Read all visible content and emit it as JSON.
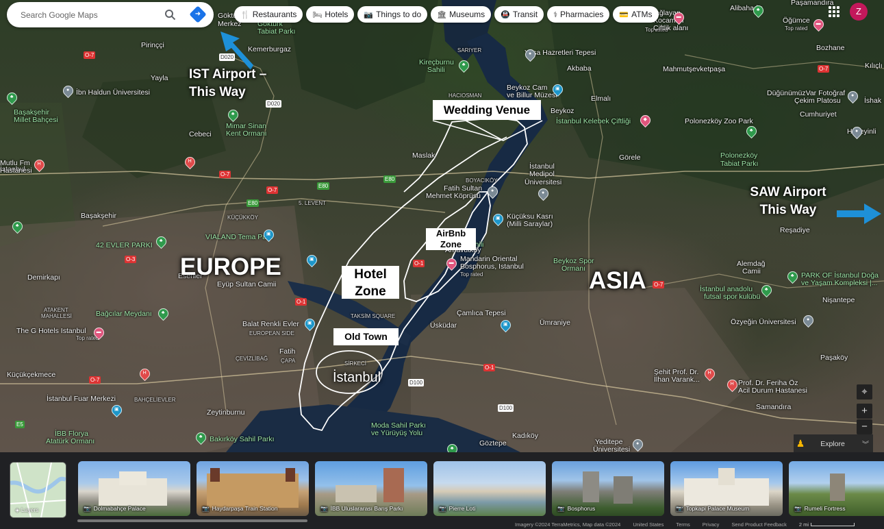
{
  "search": {
    "placeholder": "Search Google Maps"
  },
  "chips": [
    {
      "icon": "restaurant-icon",
      "glyph": "🍴",
      "label": "Restaurants"
    },
    {
      "icon": "bed-icon",
      "glyph": "🛏",
      "label": "Hotels"
    },
    {
      "icon": "camera-icon",
      "glyph": "📷",
      "label": "Things to do"
    },
    {
      "icon": "museum-icon",
      "glyph": "🏛",
      "label": "Museums"
    },
    {
      "icon": "transit-icon",
      "glyph": "🚇",
      "label": "Transit"
    },
    {
      "icon": "pharmacy-icon",
      "glyph": "⚕",
      "label": "Pharmacies"
    },
    {
      "icon": "atm-icon",
      "glyph": "💳",
      "label": "ATMs"
    }
  ],
  "user": {
    "initial": "Z"
  },
  "annotations": {
    "europe": "EUROPE",
    "asia": "ASIA",
    "ist_airport_1": "IST Airport –",
    "ist_airport_2": "This Way",
    "saw_airport_1": "SAW Airport",
    "saw_airport_2": "This Way",
    "wedding_venue": "Wedding Venue",
    "airbnb_1": "AirBnb",
    "airbnb_2": "Zone",
    "hotel_1": "Hotel",
    "hotel_2": "Zone",
    "old_town": "Old Town"
  },
  "accent": {
    "arrow": "#1e90d8",
    "route": "#ffffff"
  },
  "places": [
    {
      "text": "Kemerburgaz",
      "style": ""
    },
    {
      "text": "Göktürk",
      "style": ""
    },
    {
      "text": "Merkez",
      "style": ""
    },
    {
      "text": "Göktürk",
      "style": "green"
    },
    {
      "text": "Tabiat Parkı",
      "style": "green"
    },
    {
      "text": "Pirinççi",
      "style": ""
    },
    {
      "text": "Yayla",
      "style": ""
    },
    {
      "text": "İbn Haldun Üniversitesi",
      "style": ""
    },
    {
      "text": "Başakşehir",
      "style": "green"
    },
    {
      "text": "Millet Bahçesi",
      "style": "green"
    },
    {
      "text": "Cebeci",
      "style": ""
    },
    {
      "text": "Mimar Sinan",
      "style": "green"
    },
    {
      "text": "Kent Ormanı",
      "style": "green"
    },
    {
      "text": "Başakşehir",
      "style": ""
    },
    {
      "text": "42 EVLER PARKI",
      "style": "green"
    },
    {
      "text": "VIALAND Tema Park",
      "style": "green"
    },
    {
      "text": "Eyüp Sultan Camii",
      "style": ""
    },
    {
      "text": "Bağcılar Meydanı",
      "style": "green"
    },
    {
      "text": "The G Hotels Istanbul",
      "style": ""
    },
    {
      "text": "Top rated",
      "style": "road"
    },
    {
      "text": "Balat Renkli Evler",
      "style": ""
    },
    {
      "text": "Fatih",
      "style": ""
    },
    {
      "text": "Küçükçekmece",
      "style": ""
    },
    {
      "text": "İstanbul Fuar Merkezi",
      "style": ""
    },
    {
      "text": "Zeytinburnu",
      "style": ""
    },
    {
      "text": "İBB Florya",
      "style": "green"
    },
    {
      "text": "Atatürk Ormanı",
      "style": "green"
    },
    {
      "text": "Bakırköy Sahil Parkı",
      "style": "green"
    },
    {
      "text": "Moda Sahil Parkı",
      "style": "green"
    },
    {
      "text": "ve Yürüyüş Yolu",
      "style": "green"
    },
    {
      "text": "Kadıköy",
      "style": ""
    },
    {
      "text": "Göztepe",
      "style": ""
    },
    {
      "text": "Yeditepe",
      "style": ""
    },
    {
      "text": "Üniversitesi",
      "style": ""
    },
    {
      "text": "Üsküdar",
      "style": ""
    },
    {
      "text": "Çamlıca Tepesi",
      "style": ""
    },
    {
      "text": "Ümraniye",
      "style": ""
    },
    {
      "text": "Mandarin Oriental",
      "style": ""
    },
    {
      "text": "Bosphorus, Istanbul",
      "style": ""
    },
    {
      "text": "Top rated",
      "style": "road"
    },
    {
      "text": "Küçüksu Kasrı",
      "style": ""
    },
    {
      "text": "(Milli Saraylar)",
      "style": ""
    },
    {
      "text": "Fatih Sultan",
      "style": ""
    },
    {
      "text": "Mehmet Köprüsü",
      "style": ""
    },
    {
      "text": "Maslak",
      "style": ""
    },
    {
      "text": "İstanbul",
      "style": ""
    },
    {
      "text": "Medipol",
      "style": ""
    },
    {
      "text": "Üniversitesi",
      "style": ""
    },
    {
      "text": "Beykoz Cam",
      "style": ""
    },
    {
      "text": "ve Billur Müzesi",
      "style": ""
    },
    {
      "text": "Beykoz",
      "style": ""
    },
    {
      "text": "İstanbul Kelebek Çiftliği",
      "style": "green"
    },
    {
      "text": "Yuşa Hazretleri Tepesi",
      "style": ""
    },
    {
      "text": "Akbaba",
      "style": ""
    },
    {
      "text": "Kireçburnu",
      "style": "green"
    },
    {
      "text": "Sahili",
      "style": "green"
    },
    {
      "text": "SARIYER",
      "style": "road"
    },
    {
      "text": "Elmalı",
      "style": ""
    },
    {
      "text": "Görele",
      "style": ""
    },
    {
      "text": "Polonezköy Zoo Park",
      "style": ""
    },
    {
      "text": "Polonezköy",
      "style": "green"
    },
    {
      "text": "Tabiat Parkı",
      "style": "green"
    },
    {
      "text": "Mahmutşevketpaşa",
      "style": ""
    },
    {
      "text": "Alibahadır",
      "style": ""
    },
    {
      "text": "Paşamandıra",
      "style": ""
    },
    {
      "text": "Öğümce",
      "style": ""
    },
    {
      "text": "Top rated",
      "style": "road"
    },
    {
      "text": "Bozhane",
      "style": ""
    },
    {
      "text": "Kılıçlı",
      "style": ""
    },
    {
      "text": "DüğünümüzVar Fotoğraf",
      "style": ""
    },
    {
      "text": "Çekim Platosu",
      "style": ""
    },
    {
      "text": "Cumhuriyet",
      "style": ""
    },
    {
      "text": "İshak",
      "style": ""
    },
    {
      "text": "Hüseyinli",
      "style": ""
    },
    {
      "text": "Reşadiye",
      "style": ""
    },
    {
      "text": "Alemdağ",
      "style": ""
    },
    {
      "text": "Camii",
      "style": ""
    },
    {
      "text": "Beykoz Spor",
      "style": "green"
    },
    {
      "text": "Ormanı",
      "style": "green"
    },
    {
      "text": "PARK OF İstanbul Doğa",
      "style": "green"
    },
    {
      "text": "ve Yaşam Kompleksi |...",
      "style": "green"
    },
    {
      "text": "İstanbul anadolu",
      "style": "green"
    },
    {
      "text": "futsal spor kulübü",
      "style": "green"
    },
    {
      "text": "Nişantepe",
      "style": ""
    },
    {
      "text": "Özyeğin Üniversitesi",
      "style": ""
    },
    {
      "text": "Paşaköy",
      "style": ""
    },
    {
      "text": "Şehit Prof. Dr.",
      "style": ""
    },
    {
      "text": "İlhan Varank...",
      "style": ""
    },
    {
      "text": "Prof. Dr. Feriha Öz",
      "style": ""
    },
    {
      "text": "Acil Durum Hastanesi",
      "style": ""
    },
    {
      "text": "Samandıra",
      "style": ""
    },
    {
      "text": "Sağlayan",
      "style": ""
    },
    {
      "text": "Top rated",
      "style": "road"
    },
    {
      "text": "İstanbul",
      "style": ""
    },
    {
      "text": "Bebek Sahili",
      "style": "green"
    },
    {
      "text": "Arnavutköy",
      "style": ""
    },
    {
      "text": "TAKSİM SQUARE",
      "style": "road"
    },
    {
      "text": "SİRKECİ",
      "style": "road"
    },
    {
      "text": "EUROPEAN SIDE",
      "style": "road"
    },
    {
      "text": "ÇEVİZLİBAĞ",
      "style": "road"
    },
    {
      "text": "ÇAPA",
      "style": "road"
    },
    {
      "text": "BAHÇELİEVLER",
      "style": "road"
    },
    {
      "text": "ATAKENT",
      "style": "road"
    },
    {
      "text": "MAHALLESİ",
      "style": "road"
    },
    {
      "text": "KÜÇÜKKÖY",
      "style": "road"
    },
    {
      "text": "5. LEVENT",
      "style": "road"
    },
    {
      "text": "HACIOSMAN",
      "style": "road"
    },
    {
      "text": "BOYACIKÖY",
      "style": "road"
    },
    {
      "text": "Mutlu Fm",
      "style": ""
    },
    {
      "text": "Hastanesi",
      "style": ""
    },
    {
      "text": "Kocaman",
      "style": ""
    },
    {
      "text": "Çiftlik alanı",
      "style": ""
    },
    {
      "text": "Esenler",
      "style": ""
    },
    {
      "text": "Demirkapı",
      "style": ""
    }
  ],
  "roads": [
    "D020",
    "D020",
    "O-7",
    "O-7",
    "O-7",
    "E80",
    "E80",
    "E80",
    "O-3",
    "O-1",
    "O-1",
    "O-1",
    "D100",
    "D100",
    "O-7",
    "E5",
    "O-7",
    "O-7"
  ],
  "controls": {
    "zoom_in": "+",
    "zoom_out": "−",
    "locate": "⌖"
  },
  "explore": {
    "label": "Explore"
  },
  "layers": {
    "label": "Layers"
  },
  "thumbnails": [
    {
      "label": "Dolmabahçe Palace"
    },
    {
      "label": "Haydarpaşa Train Station"
    },
    {
      "label": "İBB Uluslararası Barış Parkı"
    },
    {
      "label": "Pierre Loti"
    },
    {
      "label": "Bosphorus"
    },
    {
      "label": "Topkapi Palace Museum"
    },
    {
      "label": "Rumeli Fortress"
    }
  ],
  "footer": {
    "imagery": "Imagery ©2024 TerraMetrics, Map data ©2024",
    "country": "United States",
    "terms": "Terms",
    "privacy": "Privacy",
    "feedback": "Send Product Feedback",
    "scale": "2 mi"
  }
}
